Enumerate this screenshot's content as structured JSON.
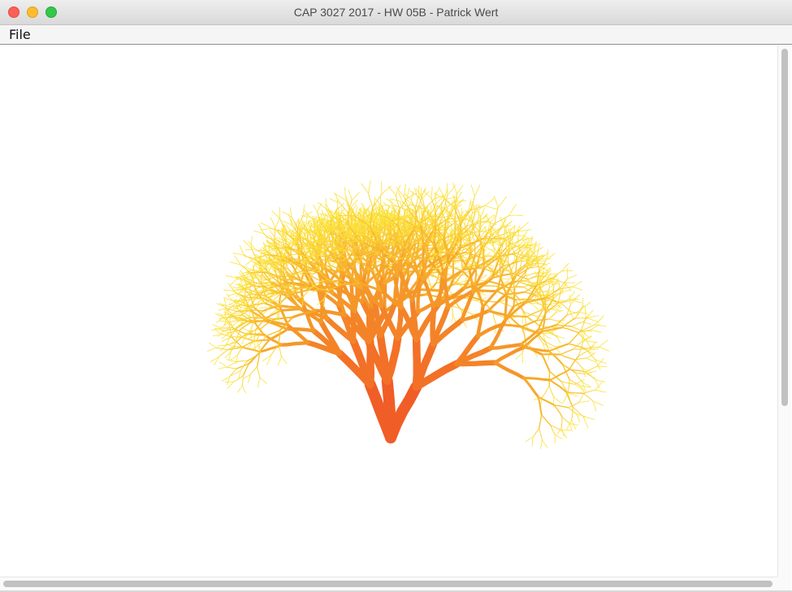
{
  "window": {
    "title": "CAP 3027 2017 - HW 05B - Patrick Wert",
    "buttons": {
      "close_icon": "close-icon",
      "minimize_icon": "minimize-icon",
      "zoom_icon": "zoom-icon"
    }
  },
  "menubar": {
    "items": [
      {
        "label": "File"
      }
    ]
  },
  "canvas": {
    "content": "fractal-tree",
    "colors": {
      "trunk": "#f04a25",
      "mid": "#f6a02a",
      "tips": "#fbe23a"
    }
  },
  "scrollbars": {
    "vertical_visible": true,
    "horizontal_visible": true
  }
}
